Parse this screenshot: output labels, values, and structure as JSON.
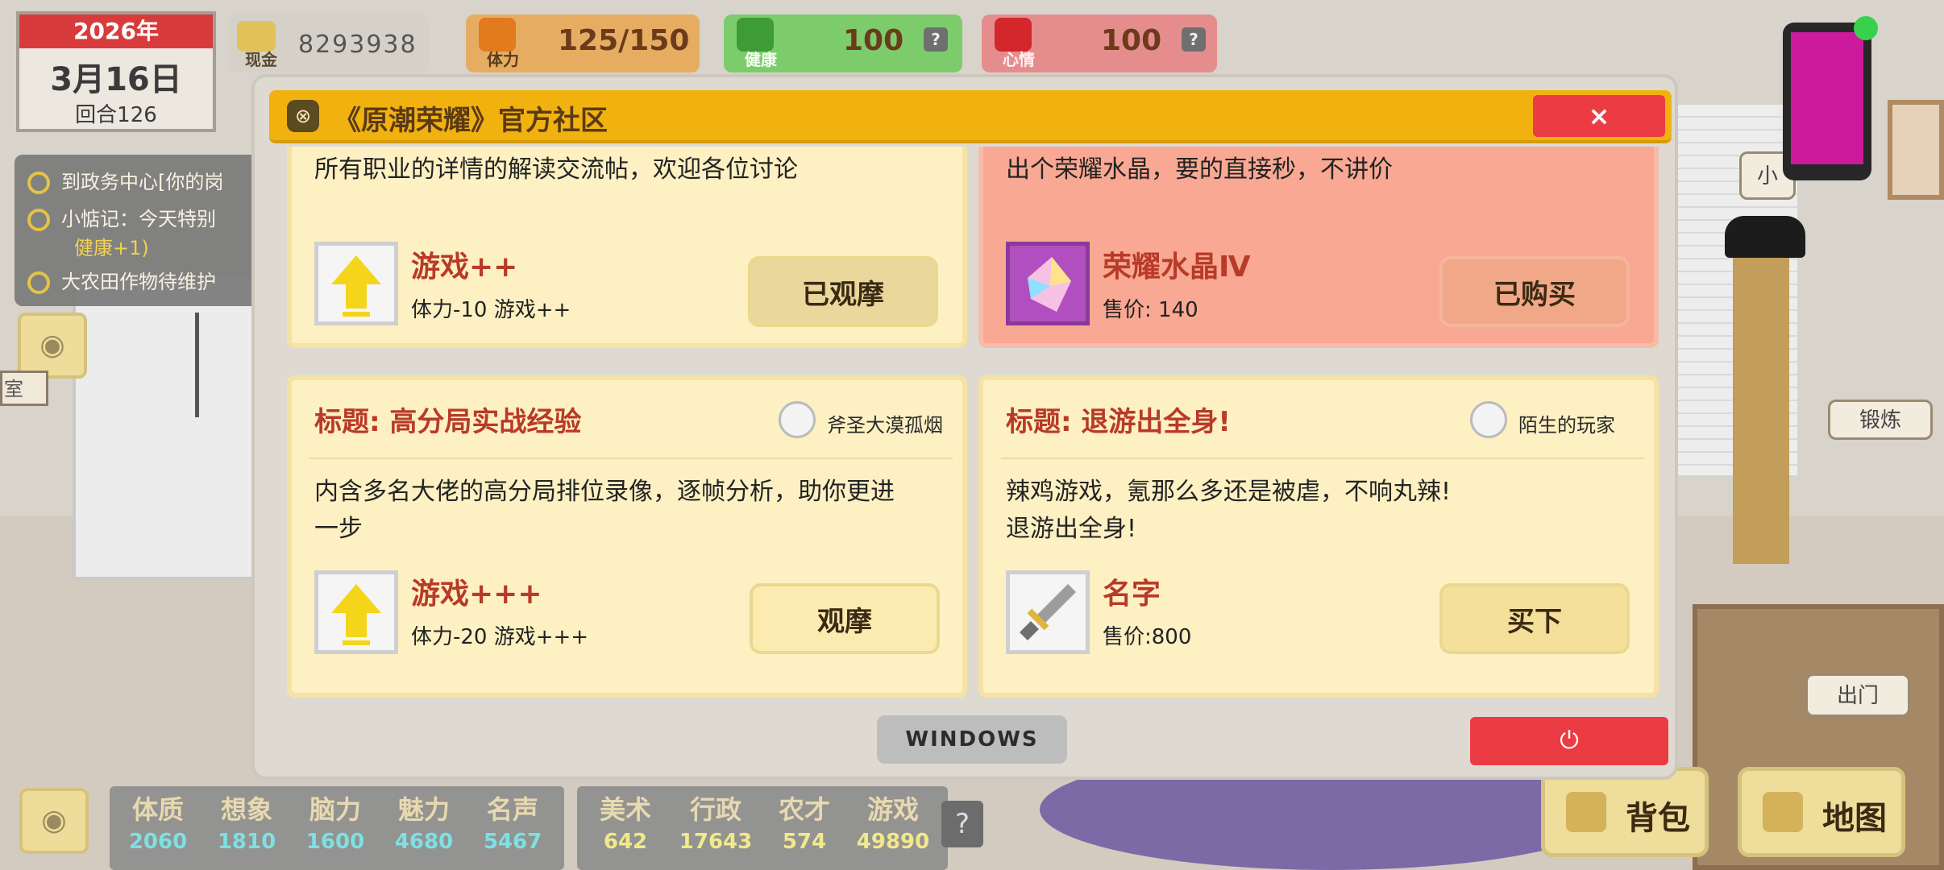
{
  "hud": {
    "year": "2026年",
    "day": "3月16日",
    "round": "回合126",
    "cash_label": "现金",
    "cash_value": "8293938",
    "energy_label": "体力",
    "energy_value": "125/150",
    "health_label": "健康",
    "health_value": "100",
    "mood_label": "心情",
    "mood_value": "100",
    "help": "?"
  },
  "quests": [
    {
      "text": "到政务中心[你的岗"
    },
    {
      "text": "小惦记：今天特别",
      "sub": "健康+1)"
    },
    {
      "text": "大农田作物待维护"
    }
  ],
  "side_tag": "室",
  "room_labels": {
    "exercise": "锻炼",
    "go_out": "出门",
    "bubble_partial": "小"
  },
  "attributes_left": [
    {
      "name": "体质",
      "value": "2060"
    },
    {
      "name": "想象",
      "value": "1810"
    },
    {
      "name": "脑力",
      "value": "1600"
    },
    {
      "name": "魅力",
      "value": "4680"
    },
    {
      "name": "名声",
      "value": "5467"
    }
  ],
  "attributes_right": [
    {
      "name": "美术",
      "value": "642"
    },
    {
      "name": "行政",
      "value": "17643"
    },
    {
      "name": "农才",
      "value": "574"
    },
    {
      "name": "游戏",
      "value": "49890"
    }
  ],
  "attr_help": "?",
  "bottom_buttons": {
    "bag": "背包",
    "map": "地图"
  },
  "colors": {
    "left_attr_value": "#7ee0e3",
    "right_attr_value": "#f2e98a",
    "title_bar": "#f1b20f",
    "close": "#ec3c43"
  },
  "window": {
    "title": "《原潮荣耀》官方社区",
    "close": "×",
    "taskbar_label": "WINDOWS",
    "power_icon": "power-icon"
  },
  "posts": [
    {
      "body_partial": "所有职业的详情的解读交流帖，欢迎各位讨论",
      "item_name": "游戏++",
      "item_desc": "体力-10 游戏++",
      "button": "已观摩",
      "thumb_icon": "up-arrow-icon"
    },
    {
      "body_partial": "出个荣耀水晶，要的直接秒，不讲价",
      "item_name": "荣耀水晶Ⅳ",
      "item_desc": "售价: 140",
      "button": "已购买",
      "thumb_icon": "crystal-icon"
    },
    {
      "title": "标题: 高分局实战经验",
      "author": "斧圣大漠孤烟",
      "body": [
        "内含多名大佬的高分局排位录像，逐帧分析，助你更进",
        "一步"
      ],
      "item_name": "游戏+++",
      "item_desc": "体力-20 游戏+++",
      "button": "观摩",
      "thumb_icon": "up-arrow-icon"
    },
    {
      "title": "标题: 退游出全身!",
      "author": "陌生的玩家",
      "body": [
        "辣鸡游戏，氪那么多还是被虐，不响丸辣!",
        "退游出全身!"
      ],
      "item_name": "名字",
      "item_desc": "售价:800",
      "button": "买下",
      "thumb_icon": "sword-icon"
    }
  ]
}
